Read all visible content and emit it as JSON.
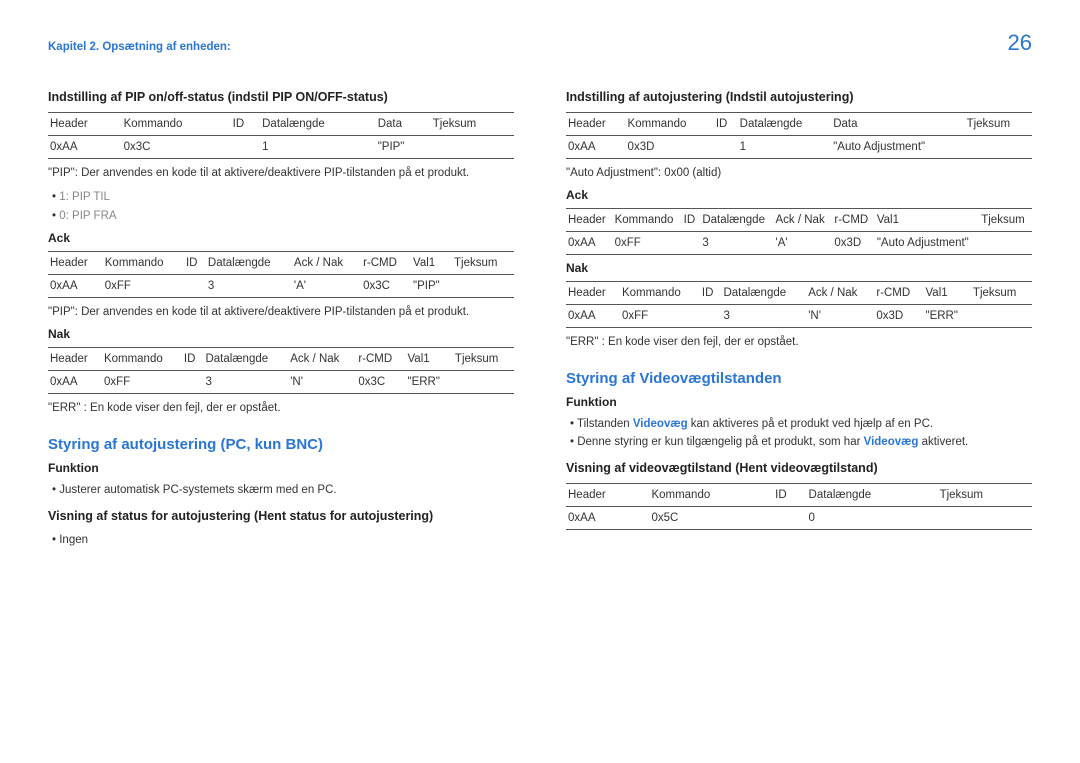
{
  "breadcrumb": "Kapitel 2. Opsætning af enheden:",
  "page_number": "26",
  "left": {
    "s1_title": "Indstilling af PIP on/off-status (indstil PIP ON/OFF-status)",
    "t1_headers": [
      "Header",
      "Kommando",
      "ID",
      "Datalængde",
      "Data",
      "Tjeksum"
    ],
    "t1_row": [
      "0xAA",
      "0x3C",
      "",
      "1",
      "\"PIP\"",
      ""
    ],
    "s1_note": "\"PIP\": Der anvendes en kode til at aktivere/deaktivere PIP-tilstanden på et produkt.",
    "s1_b1": "1: PIP TIL",
    "s1_b2": "0: PIP FRA",
    "ack_label": "Ack",
    "t2_headers": [
      "Header",
      "Kommando",
      "ID",
      "Datalængde",
      "Ack / Nak",
      "r-CMD",
      "Val1",
      "Tjeksum"
    ],
    "t2_row": [
      "0xAA",
      "0xFF",
      "",
      "3",
      "'A'",
      "0x3C",
      "\"PIP\"",
      ""
    ],
    "t2_note": "\"PIP\": Der anvendes en kode til at aktivere/deaktivere PIP-tilstanden på et produkt.",
    "nak_label": "Nak",
    "t3_headers": [
      "Header",
      "Kommando",
      "ID",
      "Datalængde",
      "Ack / Nak",
      "r-CMD",
      "Val1",
      "Tjeksum"
    ],
    "t3_row": [
      "0xAA",
      "0xFF",
      "",
      "3",
      "'N'",
      "0x3C",
      "\"ERR\"",
      ""
    ],
    "t3_note": "\"ERR\" : En kode viser den fejl, der er opstået.",
    "s2_title": "Styring af autojustering (PC, kun BNC)",
    "s2_func_label": "Funktion",
    "s2_b1": "Justerer automatisk PC-systemets skærm med en PC.",
    "s2_sub": "Visning af status for autojustering (Hent status for autojustering)",
    "s2_b2": "Ingen"
  },
  "right": {
    "s1_title": "Indstilling af autojustering (Indstil autojustering)",
    "t1_headers": [
      "Header",
      "Kommando",
      "ID",
      "Datalængde",
      "Data",
      "Tjeksum"
    ],
    "t1_row": [
      "0xAA",
      "0x3D",
      "",
      "1",
      "\"Auto Adjustment\"",
      ""
    ],
    "s1_note": "\"Auto Adjustment\": 0x00 (altid)",
    "ack_label": "Ack",
    "t2_headers": [
      "Header",
      "Kommando",
      "ID",
      "Datalængde",
      "Ack / Nak",
      "r-CMD",
      "Val1",
      "Tjeksum"
    ],
    "t2_row": [
      "0xAA",
      "0xFF",
      "",
      "3",
      "'A'",
      "0x3D",
      "\"Auto Adjustment\"",
      ""
    ],
    "nak_label": "Nak",
    "t3_headers": [
      "Header",
      "Kommando",
      "ID",
      "Datalængde",
      "Ack / Nak",
      "r-CMD",
      "Val1",
      "Tjeksum"
    ],
    "t3_row": [
      "0xAA",
      "0xFF",
      "",
      "3",
      "'N'",
      "0x3D",
      "\"ERR\"",
      ""
    ],
    "t3_note": "\"ERR\" : En kode viser den fejl, der er opstået.",
    "s2_title": "Styring af Videovægtilstanden",
    "s2_func_label": "Funktion",
    "s2_b1_pre": "Tilstanden ",
    "s2_b1_link": "Videovæg",
    "s2_b1_post": " kan aktiveres på et produkt ved hjælp af en PC.",
    "s2_b2_pre": "Denne styring er kun tilgængelig på et produkt, som har ",
    "s2_b2_link": "Videovæg",
    "s2_b2_post": " aktiveret.",
    "s2_sub": "Visning af videovægtilstand (Hent videovægtilstand)",
    "t4_headers": [
      "Header",
      "Kommando",
      "ID",
      "Datalængde",
      "Tjeksum"
    ],
    "t4_row": [
      "0xAA",
      "0x5C",
      "",
      "0",
      ""
    ]
  }
}
